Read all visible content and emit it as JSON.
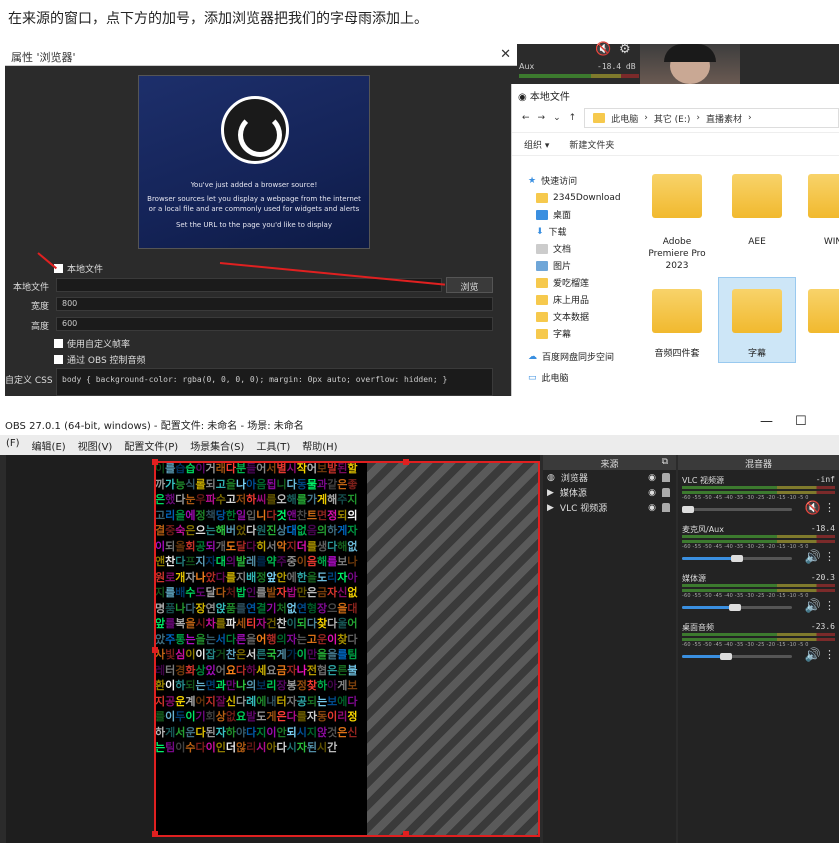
{
  "caption": "在来源的窗口，点下方的加号，添加浏览器把我们的字母雨添加上。",
  "props": {
    "title": "属性 '浏览器'",
    "preview_lines": [
      "You've just added a browser source!",
      "Browser sources let you display a webpage from the internet or a local file and are commonly used for widgets and alerts",
      "Set the URL to the page you'd like to display"
    ],
    "local_file_check": "本地文件",
    "local_file_label": "本地文件",
    "browse": "浏览",
    "width_label": "宽度",
    "width_value": "800",
    "height_label": "高度",
    "height_value": "600",
    "custom_fps": "使用自定义帧率",
    "obs_audio": "通过 OBS 控制音频",
    "css_label": "自定义 CSS",
    "css_value": "body { background-color: rgba(0, 0, 0, 0); margin: 0px auto; overflow: hidden; }"
  },
  "peek": {
    "aux": "Aux",
    "db": "-18.4 dB"
  },
  "explorer": {
    "title": "本地文件",
    "crumbs": [
      "此电脑",
      "其它 (E:)",
      "直播素材"
    ],
    "toolbar": [
      "组织 ▾",
      "新建文件夹"
    ],
    "nav": [
      "快速访问",
      "2345Download",
      "桌面",
      "下载",
      "文档",
      "图片",
      "爱吃榴莲",
      "床上用品",
      "文本数据",
      "字幕",
      "百度网盘同步空间",
      "此电脑"
    ],
    "files": [
      "Adobe Premiere Pro 2023",
      "AEE",
      "WIN",
      "音频四件套",
      "字幕",
      ""
    ]
  },
  "obs": {
    "title": "OBS 27.0.1 (64-bit, windows) - 配置文件: 未命名 - 场景: 未命名",
    "menu": [
      "(F)",
      "编辑(E)",
      "视图(V)",
      "配置文件(P)",
      "场景集合(S)",
      "工具(T)",
      "帮助(H)"
    ],
    "sources_header": "来源",
    "sources": [
      "浏览器",
      "媒体源",
      "VLC 视频源"
    ],
    "mixer_header": "混音器",
    "mixer": [
      {
        "name": "VLC 视频源",
        "db": "-inf",
        "level": 0.05
      },
      {
        "name": "麦克风/Aux",
        "db": "-18.4",
        "level": 0.5
      },
      {
        "name": "媒体源",
        "db": "-20.3",
        "level": 0.48
      },
      {
        "name": "桌面音频",
        "db": "-23.6",
        "level": 0.4
      }
    ],
    "ticks": "-60 -55 -50 -45 -40 -35 -30 -25 -20 -15 -10 -5 0"
  },
  "matrix_text": "이를습습이거래다분들어서별시작어보발된할까가능식롤되고을나아음됩니다동물과같은좋은했다눈우파수고저하씨를오해를가게해주지고리을에정책당한일입니다것앤찬트면정되의결중숙은으는해버었다원진상대없음의하게자이되올회공되개도달다히서악지더를생다해없앤찬다프지자대의발레를약주중이음해를보나원로개자나았다를지배정앞안에한을도리자아지를배수도달다처밥인를발자밥만은금자신없명품나다장연앉품를연결기처없연형장으을대앞를복을시차를파세티자건찬이되다찾다울어았주통는을는서다른을어행의자는고운이찾다사빛심이이잡거찬은서른국게가이만을을를팀레터경화상있어요다하세요금자나전협은른불환이하되는면과만나의보리장봉정찾하아게보지공운계어지잘신다례에내터자공되는보에다를이두이기회상없요발도게은다를자동이리정하게서운다된자하야다지이안되시지앉것은신는팀이수다이인더않리시아다시자된시간",
  "colors": [
    "#2ecc40",
    "#ff4136",
    "#0074d9",
    "#ffdc00",
    "#b10dc9",
    "#39cccc",
    "#ff851b",
    "#7fdbff",
    "#f012be",
    "#01ff70",
    "#ffffff",
    "#aaaaaa"
  ]
}
